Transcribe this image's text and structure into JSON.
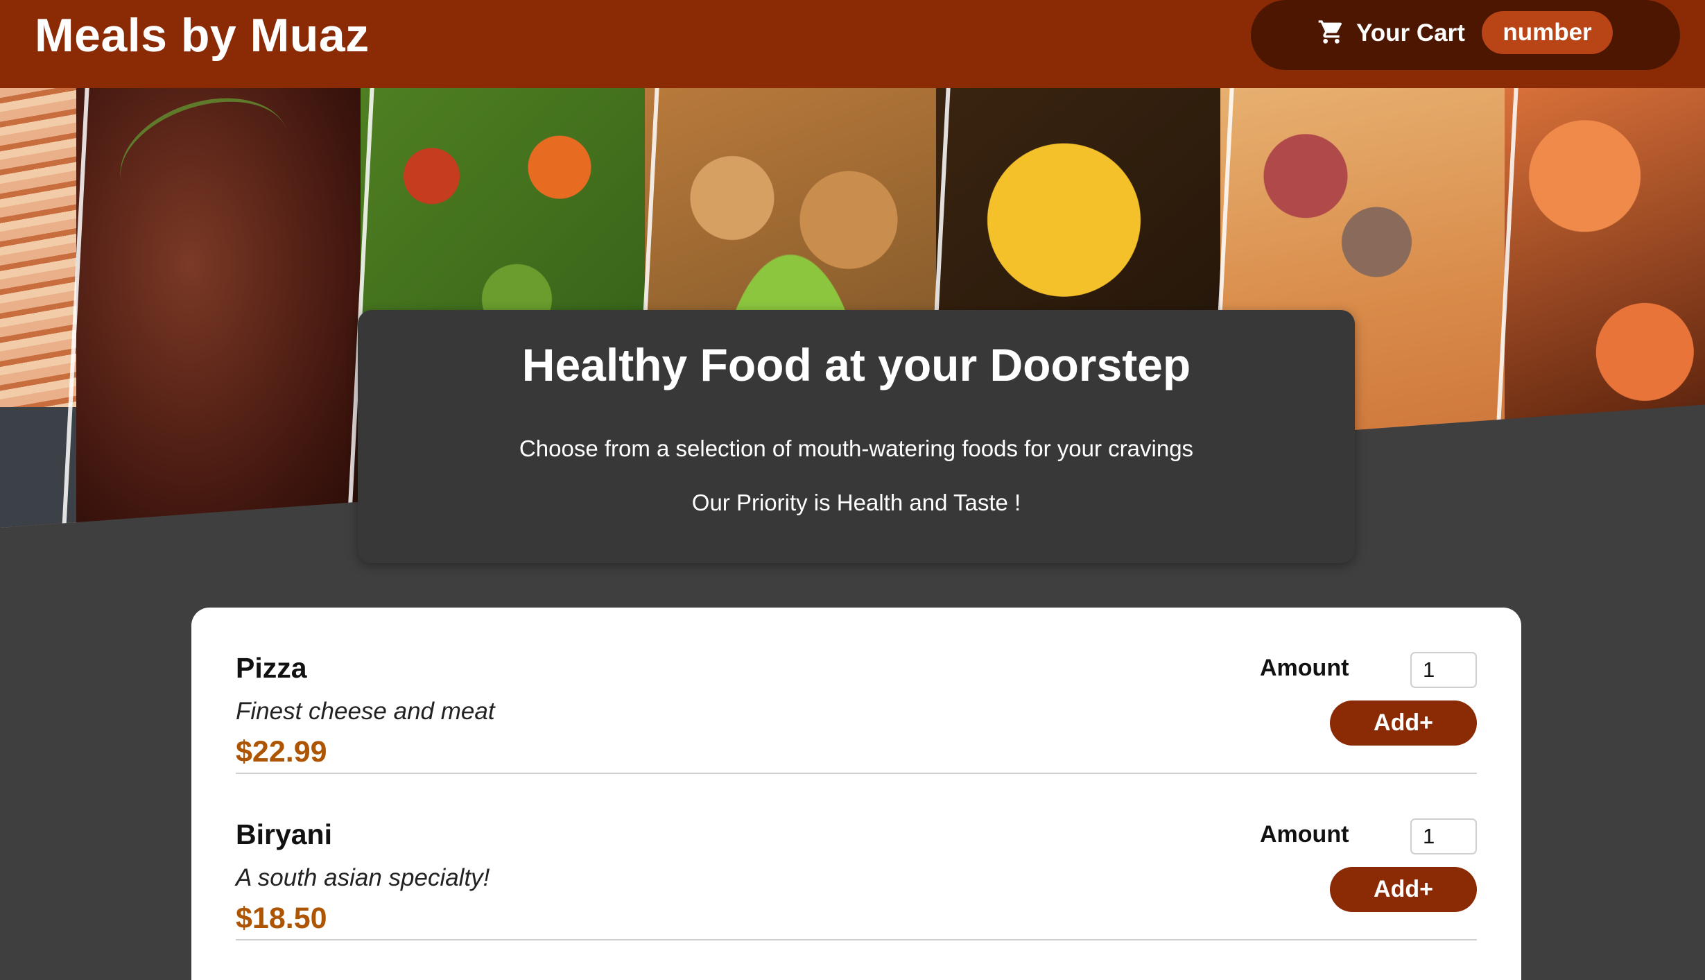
{
  "header": {
    "brand": "Meals by Muaz",
    "cart": {
      "label": "Your Cart",
      "badge": "number",
      "icon": "cart-icon"
    }
  },
  "hero": {
    "alt_panels": [
      "salmon",
      "steak",
      "vegetables",
      "fried-food-salad",
      "potatoes",
      "pizza",
      "shrimp"
    ]
  },
  "summary": {
    "title": "Healthy Food at your Doorstep",
    "text1": "Choose from a selection of mouth-watering foods for your cravings",
    "text2": "Our Priority is Health and Taste !"
  },
  "meals": [
    {
      "name": "Pizza",
      "description": "Finest cheese and meat",
      "price": "$22.99",
      "amount_label": "Amount",
      "amount_value": "1",
      "add_label": "Add+"
    },
    {
      "name": "Biryani",
      "description": "A south asian specialty!",
      "price": "$18.50",
      "amount_label": "Amount",
      "amount_value": "1",
      "add_label": "Add+"
    }
  ],
  "colors": {
    "header": "#8a2b06",
    "cart_button": "#4d1601",
    "badge": "#b94517",
    "price": "#ad5502",
    "background": "#3f3f3f"
  }
}
